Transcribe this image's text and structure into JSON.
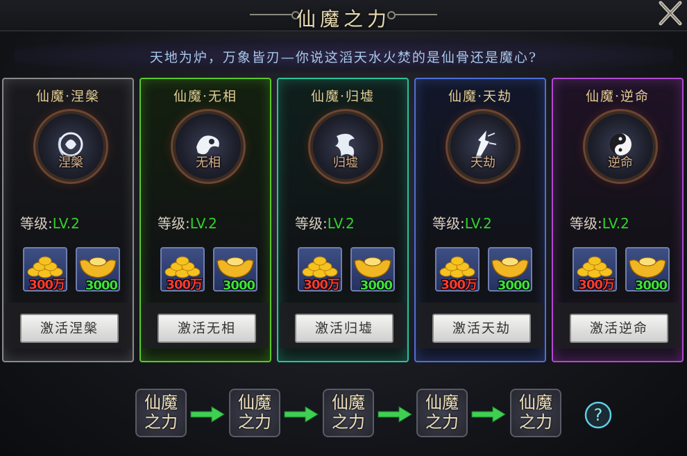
{
  "window": {
    "title": "仙魔之力"
  },
  "banner": {
    "text": "天地为炉，万象皆刃—你说这滔天水火焚的是仙骨还是魔心?"
  },
  "level_label": "等级:",
  "cards": [
    {
      "name": "仙魔·涅槃",
      "emblem_label": "涅槃",
      "level": "LV.2",
      "gold": "300万",
      "ingot": "3000",
      "button": "激活涅槃",
      "accent": "#8a8a8a",
      "tint": "#1b1b1f"
    },
    {
      "name": "仙魔·无相",
      "emblem_label": "无相",
      "level": "LV.2",
      "gold": "300万",
      "ingot": "3000",
      "button": "激活无相",
      "accent": "#5cc82a",
      "tint": "#13200f"
    },
    {
      "name": "仙魔·归墟",
      "emblem_label": "归墟",
      "level": "LV.2",
      "gold": "300万",
      "ingot": "3000",
      "button": "激活归墟",
      "accent": "#2bc39a",
      "tint": "#0f1f1c"
    },
    {
      "name": "仙魔·天劫",
      "emblem_label": "天劫",
      "level": "LV.2",
      "gold": "300万",
      "ingot": "3000",
      "button": "激活天劫",
      "accent": "#4f6fd8",
      "tint": "#12172a"
    },
    {
      "name": "仙魔·逆命",
      "emblem_label": "逆命",
      "level": "LV.2",
      "gold": "300万",
      "ingot": "3000",
      "button": "激活逆命",
      "accent": "#b24ad0",
      "tint": "#1f1226"
    }
  ],
  "flow": [
    {
      "line1": "仙魔",
      "line2": "之力"
    },
    {
      "line1": "仙魔",
      "line2": "之力"
    },
    {
      "line1": "仙魔",
      "line2": "之力"
    },
    {
      "line1": "仙魔",
      "line2": "之力"
    },
    {
      "line1": "仙魔",
      "line2": "之力"
    }
  ],
  "icons": {
    "close": "close-icon",
    "help": "question-icon",
    "gold": "gold-coins-icon",
    "ingot": "gold-ingot-icon",
    "arrow": "arrow-right-icon"
  }
}
